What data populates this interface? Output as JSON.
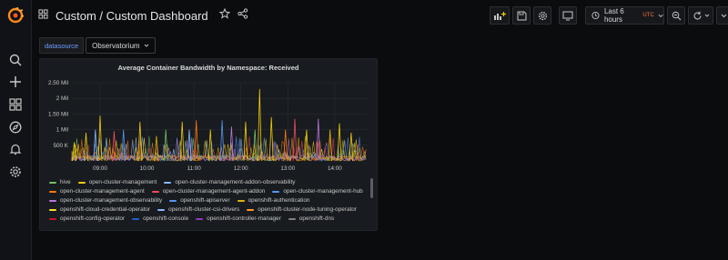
{
  "header": {
    "breadcrumb": "Custom / Custom Dashboard",
    "time_range": "Last 6 hours",
    "timezone": "UTC"
  },
  "variables": {
    "label": "datasource",
    "value": "Observatorium"
  },
  "panel": {
    "title": "Average Container Bandwidth by Namespace: Received",
    "chart_data": {
      "type": "line",
      "title": "Average Container Bandwidth by Namespace: Received",
      "y_ticks": [
        "500 K",
        "1 Mil",
        "1.50 Mil",
        "2 Mil",
        "2.50 Mil"
      ],
      "y_tick_values": [
        500000,
        1000000,
        1500000,
        2000000,
        2500000
      ],
      "x_ticks": [
        "09:00",
        "10:00",
        "11:00",
        "12:00",
        "13:00",
        "14:00"
      ],
      "x_tick_values": [
        9,
        10,
        11,
        12,
        13,
        14
      ],
      "xlim": [
        8.4,
        14.7
      ],
      "ylim": [
        0,
        2500000
      ],
      "spikes": [
        {
          "x": 8.45,
          "y": 600000
        },
        {
          "x": 8.7,
          "y": 900000
        },
        {
          "x": 8.9,
          "y": 1000000
        },
        {
          "x": 9.0,
          "y": 1450000
        },
        {
          "x": 9.3,
          "y": 950000
        },
        {
          "x": 9.5,
          "y": 1000000
        },
        {
          "x": 9.85,
          "y": 1250000
        },
        {
          "x": 10.2,
          "y": 800000
        },
        {
          "x": 10.4,
          "y": 1000000
        },
        {
          "x": 10.75,
          "y": 1250000
        },
        {
          "x": 10.9,
          "y": 1000000
        },
        {
          "x": 11.05,
          "y": 1300000
        },
        {
          "x": 11.35,
          "y": 1000000
        },
        {
          "x": 11.6,
          "y": 1300000
        },
        {
          "x": 11.8,
          "y": 1100000
        },
        {
          "x": 12.1,
          "y": 1250000
        },
        {
          "x": 12.3,
          "y": 1000000
        },
        {
          "x": 12.4,
          "y": 2300000
        },
        {
          "x": 12.65,
          "y": 1400000
        },
        {
          "x": 12.95,
          "y": 1000000
        },
        {
          "x": 13.15,
          "y": 1350000
        },
        {
          "x": 13.4,
          "y": 1000000
        },
        {
          "x": 13.65,
          "y": 1350000
        },
        {
          "x": 13.9,
          "y": 1000000
        },
        {
          "x": 14.1,
          "y": 1200000
        },
        {
          "x": 14.35,
          "y": 900000
        }
      ],
      "series_colors": [
        "#73bf69",
        "#f2cc0c",
        "#8ab8ff",
        "#ff780a",
        "#f2495c",
        "#5794f2",
        "#b877d9",
        "#e0b400"
      ]
    }
  },
  "legend": {
    "rows": [
      [
        {
          "label": "hive",
          "color": "#73bf69"
        },
        {
          "label": "open-cluster-management",
          "color": "#f2cc0c"
        },
        {
          "label": "open-cluster-management-addon-observability",
          "color": "#8ab8ff"
        }
      ],
      [
        {
          "label": "open-cluster-management-agent",
          "color": "#ff780a"
        },
        {
          "label": "open-cluster-management-agent-addon",
          "color": "#f2495c"
        },
        {
          "label": "open-cluster-management-hub",
          "color": "#5794f2"
        }
      ],
      [
        {
          "label": "open-cluster-management-observability",
          "color": "#b877d9"
        },
        {
          "label": "openshift-apiserver",
          "color": "#5794f2"
        },
        {
          "label": "openshift-authentication",
          "color": "#e0b400"
        }
      ],
      [
        {
          "label": "openshift-cloud-credential-operator",
          "color": "#fade2a"
        },
        {
          "label": "openshift-cluster-csi-drivers",
          "color": "#8ab8ff"
        },
        {
          "label": "openshift-cluster-node-tuning-operator",
          "color": "#ff9830"
        }
      ],
      [
        {
          "label": "openshift-config-operator",
          "color": "#c4162a"
        },
        {
          "label": "openshift-console",
          "color": "#1f60c4"
        },
        {
          "label": "openshift-controller-manager",
          "color": "#8f3bb8"
        },
        {
          "label": "openshift-dns",
          "color": "#808080"
        }
      ]
    ]
  }
}
